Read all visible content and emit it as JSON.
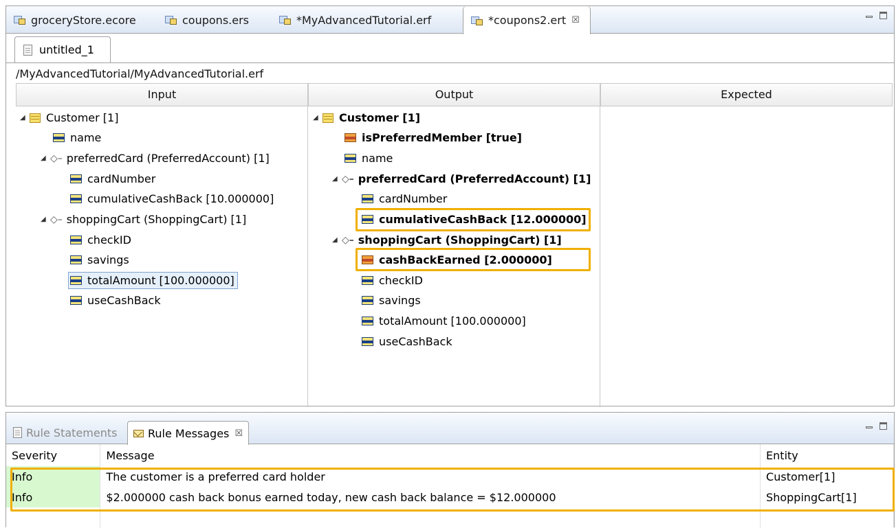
{
  "editor_tabs": [
    {
      "label": "groceryStore.ecore",
      "active": false
    },
    {
      "label": "coupons.ers",
      "active": false
    },
    {
      "label": "*MyAdvancedTutorial.erf",
      "active": false
    },
    {
      "label": "*coupons2.ert",
      "active": true
    }
  ],
  "close_glyph": "☒",
  "sub_tab": {
    "label": "untitled_1"
  },
  "path": "/MyAdvancedTutorial/MyAdvancedTutorial.erf",
  "columns": {
    "input": "Input",
    "output": "Output",
    "expected": "Expected"
  },
  "input_tree": [
    {
      "label": "Customer [1]"
    },
    {
      "label": "name"
    },
    {
      "label": "preferredCard (PreferredAccount) [1]"
    },
    {
      "label": "cardNumber"
    },
    {
      "label": "cumulativeCashBack [10.000000]"
    },
    {
      "label": "shoppingCart (ShoppingCart) [1]"
    },
    {
      "label": "checkID"
    },
    {
      "label": "savings"
    },
    {
      "label": "totalAmount [100.000000]",
      "selected": true
    },
    {
      "label": "useCashBack"
    }
  ],
  "output_tree": [
    {
      "label": "Customer [1]"
    },
    {
      "label": "isPreferredMember [true]"
    },
    {
      "label": "name"
    },
    {
      "label": "preferredCard (PreferredAccount) [1]"
    },
    {
      "label": "cardNumber"
    },
    {
      "label": "cumulativeCashBack [12.000000]"
    },
    {
      "label": "shoppingCart (ShoppingCart) [1]"
    },
    {
      "label": "cashBackEarned [2.000000]"
    },
    {
      "label": "checkID"
    },
    {
      "label": "savings"
    },
    {
      "label": "totalAmount [100.000000]"
    },
    {
      "label": "useCashBack"
    }
  ],
  "bottom_tabs": [
    {
      "label": "Rule Statements",
      "active": false
    },
    {
      "label": "Rule Messages",
      "active": true
    }
  ],
  "messages": {
    "headers": [
      "Severity",
      "Message",
      "Entity"
    ],
    "rows": [
      {
        "severity": "Info",
        "message": "The customer is a preferred card holder",
        "entity": "Customer[1]"
      },
      {
        "severity": "Info",
        "message": "$2.000000 cash back bonus earned today, new cash back balance = $12.000000",
        "entity": "ShoppingCart[1]"
      }
    ]
  },
  "colors": {
    "highlight": "#f0b000",
    "info_bg": "#d8f8d0",
    "selection": "#e6f0fb"
  }
}
